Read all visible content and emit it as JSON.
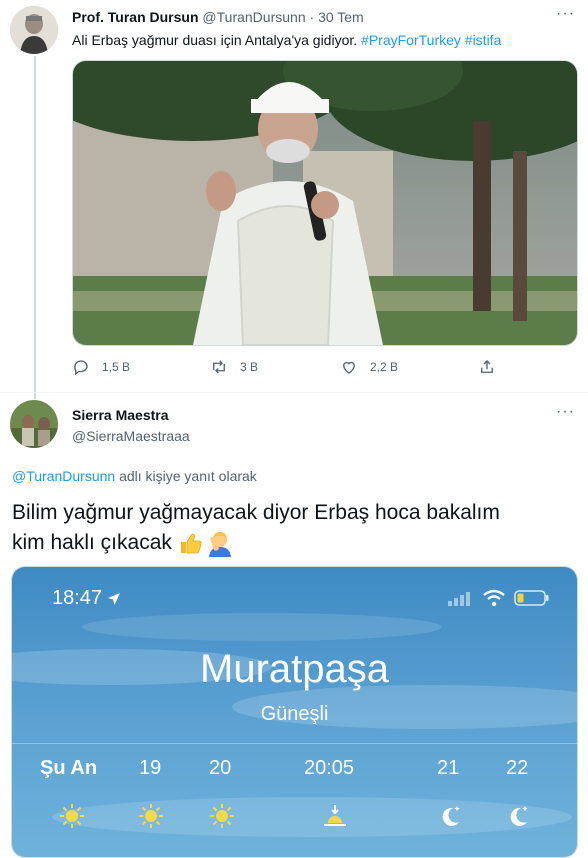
{
  "tweet1": {
    "name": "Prof. Turan Dursun",
    "handle": "@TuranDursunn",
    "sep": "·",
    "date": "30 Tem",
    "text": "Ali Erbaş yağmur duası için Antalya'ya gidiyor.",
    "hashtag1": "#PrayForTurkey",
    "hashtag2": "#istifa",
    "replies": "1,5 B",
    "retweets": "3 B",
    "likes": "2,2 B"
  },
  "tweet2": {
    "name": "Sierra Maestra",
    "handle": "@SierraMaestraaa",
    "reply_handle": "@TuranDursunn",
    "reply_suffix": "adlı kişiye yanıt olarak",
    "text_line1": "Bilim yağmur yağmayacak diyor Erbaş hoca bakalım",
    "text_line2": "kim haklı çıkacak",
    "emojis": [
      "thumbs-up",
      "person-facepalming"
    ]
  },
  "weather": {
    "time": "18:47",
    "city": "Muratpaşa",
    "condition": "Güneşli",
    "hours": [
      "Şu An",
      "19",
      "20",
      "20:05",
      "21",
      "22"
    ],
    "hour_icons": [
      "sun",
      "sun",
      "sun",
      "sunset",
      "moon-stars",
      "moon-stars"
    ]
  }
}
